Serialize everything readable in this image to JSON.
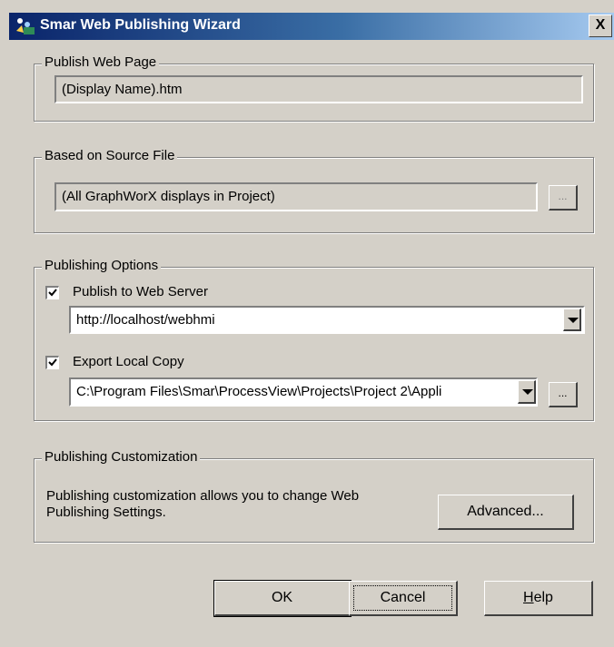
{
  "window": {
    "title": "Smar Web Publishing Wizard",
    "close_label": "X"
  },
  "publish_web_page": {
    "legend": "Publish Web Page",
    "value": "(Display Name).htm"
  },
  "source_file": {
    "legend": "Based on Source File",
    "value": "(All GraphWorX displays in Project)",
    "browse_label": "..."
  },
  "publishing_options": {
    "legend": "Publishing Options",
    "web_server": {
      "label": "Publish to Web Server",
      "checked": true,
      "value": "http://localhost/webhmi"
    },
    "local_copy": {
      "label": "Export Local Copy",
      "checked": true,
      "value": "C:\\Program Files\\Smar\\ProcessView\\Projects\\Project 2\\Appli",
      "browse_label": "..."
    }
  },
  "customization": {
    "legend": "Publishing Customization",
    "description_line1": "Publishing customization allows you to change Web",
    "description_line2": "Publishing Settings.",
    "advanced_label": "Advanced..."
  },
  "buttons": {
    "ok": "OK",
    "cancel": "Cancel",
    "help_prefix": "H",
    "help_rest": "elp"
  }
}
